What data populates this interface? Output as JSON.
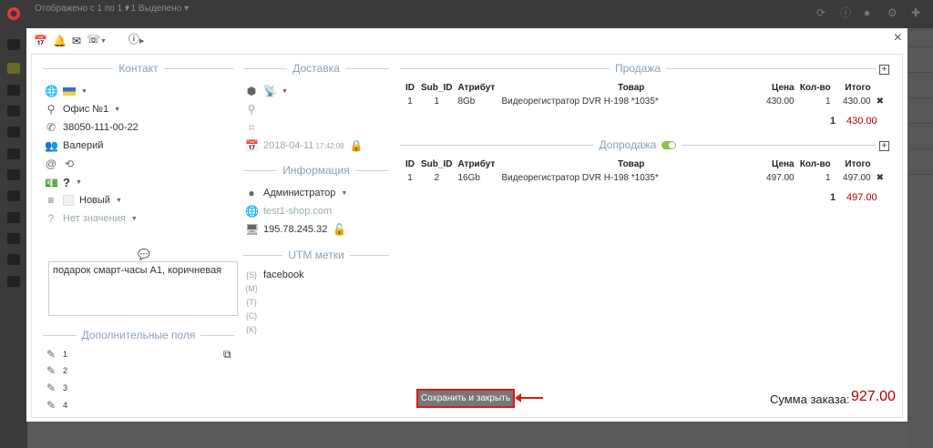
{
  "topbar": {
    "title": "Отображено с 1 по 1 ▾",
    "selected": "/ 1 Выделено ▾",
    "icons": [
      "refresh-icon",
      "info-icon",
      "user-icon",
      "gear-icon",
      "plus-icon"
    ]
  },
  "modal": {
    "head_icons": [
      "calendar-icon",
      "bell-icon",
      "mail-icon",
      "phone-icon",
      "info-icon"
    ],
    "close": "×"
  },
  "contact": {
    "title": "Контакт",
    "office": "Офис №1",
    "phone": "38050-111-00-22",
    "name": "Валерий",
    "payment": "?",
    "status": "Новый",
    "no_value": "Нет значения",
    "comment": "подарок смарт-часы A1, коричневая"
  },
  "delivery": {
    "title": "Доставка",
    "date": "2018-04-11",
    "time": "17:42:08"
  },
  "info": {
    "title": "Информация",
    "user": "Администратор",
    "site": "test1-shop.com",
    "ip": "195.78.245.32"
  },
  "utm": {
    "title": "UTM метки",
    "source": "facebook",
    "labels": [
      "{S}",
      "{M}",
      "{T}",
      "{C}",
      "{K}"
    ]
  },
  "extra": {
    "title": "Дополнительные поля",
    "fields": [
      "1",
      "2",
      "3",
      "4"
    ]
  },
  "sale": {
    "title": "Продажа",
    "headers": [
      "ID",
      "Sub_ID",
      "Атрибут",
      "Товар",
      "Цена",
      "Кол-во",
      "Итого"
    ],
    "rows": [
      {
        "id": "1",
        "sub_id": "1",
        "attr": "8Gb",
        "product": "Видеорегистратор DVR H-198 *1035*",
        "price": "430.00",
        "qty": "1",
        "total": "430.00"
      }
    ],
    "sum_qty": "1",
    "sum_total": "430.00"
  },
  "upsale": {
    "title": "Допродажа",
    "headers": [
      "ID",
      "Sub_ID",
      "Атрибут",
      "Товар",
      "Цена",
      "Кол-во",
      "Итого"
    ],
    "rows": [
      {
        "id": "1",
        "sub_id": "2",
        "attr": "16Gb",
        "product": "Видеорегистратор DVR H-198 *1035*",
        "price": "497.00",
        "qty": "1",
        "total": "497.00"
      }
    ],
    "sum_qty": "1",
    "sum_total": "497.00"
  },
  "footer": {
    "save_label": "Сохранить и закрыть",
    "total_label": "Сумма заказа:",
    "total_value": "927.00"
  },
  "colors": {
    "accent_red": "#b00000",
    "link": "#1a73c8",
    "highlight": "#e01818"
  }
}
